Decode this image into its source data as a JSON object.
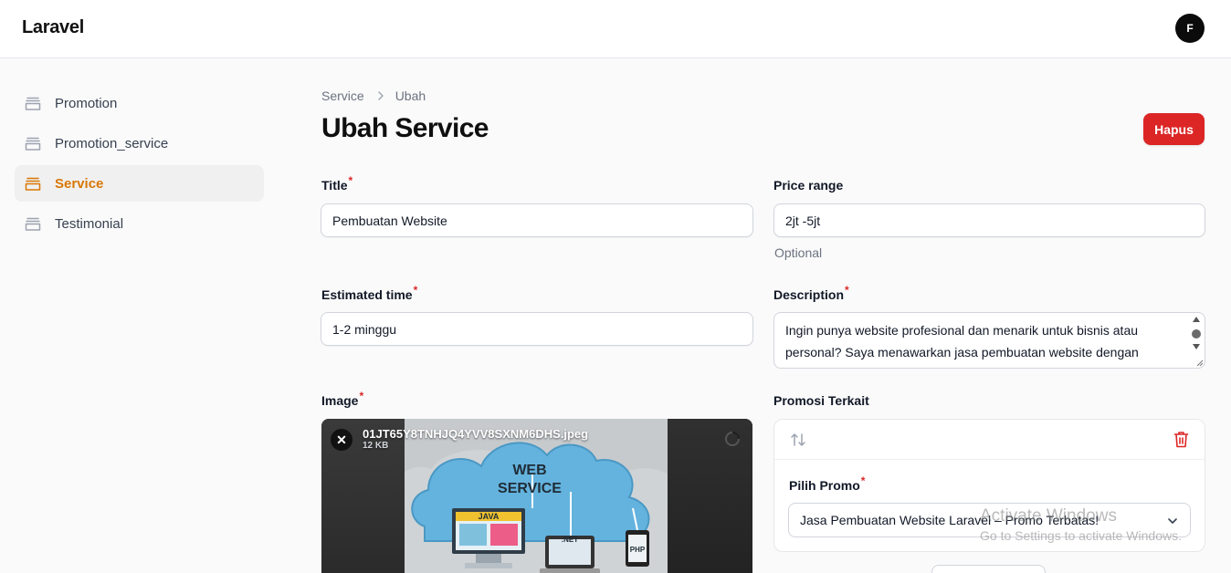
{
  "app": {
    "brand": "Laravel",
    "user_initial": "F"
  },
  "sidebar": {
    "items": [
      {
        "label": "Promotion",
        "icon": "stack-icon",
        "active": false
      },
      {
        "label": "Promotion_service",
        "icon": "stack-icon",
        "active": false
      },
      {
        "label": "Service",
        "icon": "stack-icon",
        "active": true
      },
      {
        "label": "Testimonial",
        "icon": "stack-icon",
        "active": false
      }
    ]
  },
  "breadcrumb": {
    "parent": "Service",
    "current": "Ubah"
  },
  "page": {
    "title": "Ubah Service",
    "delete_label": "Hapus"
  },
  "form": {
    "title": {
      "label": "Title",
      "required": "*",
      "value": "Pembuatan Website"
    },
    "price_range": {
      "label": "Price range",
      "value": "2jt -5jt",
      "hint": "Optional"
    },
    "estimated_time": {
      "label": "Estimated time",
      "required": "*",
      "value": "1-2 minggu"
    },
    "description": {
      "label": "Description",
      "required": "*",
      "value": "Ingin punya website profesional dan menarik untuk bisnis atau personal? Saya menawarkan jasa pembuatan website dengan"
    },
    "image": {
      "label": "Image",
      "required": "*",
      "file_name": "01JT65Y8TNHJQ4YVV8SXNM6DHS.jpeg",
      "file_size": "12 KB"
    },
    "promosi": {
      "label": "Promosi Terkait",
      "pilih_label": "Pilih Promo",
      "required": "*",
      "selected": "Jasa Pembuatan Website Laravel – Promo Terbatas!"
    }
  },
  "watermark": {
    "title": "Activate Windows",
    "subtitle": "Go to Settings to activate Windows."
  },
  "colors": {
    "accent": "#d97706",
    "danger": "#dc2626",
    "required": "#dc2626"
  }
}
